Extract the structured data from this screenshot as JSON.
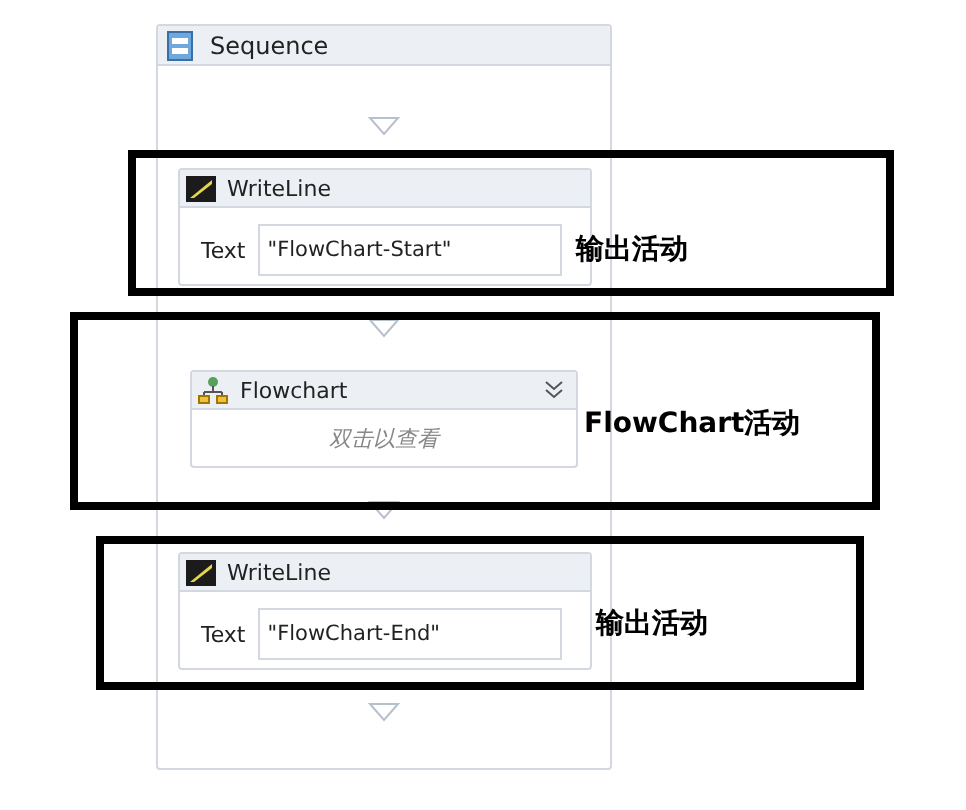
{
  "sequence": {
    "title": "Sequence",
    "activities": [
      {
        "kind": "writeline",
        "title": "WriteLine",
        "field_label": "Text",
        "value": "\"FlowChart-Start\""
      },
      {
        "kind": "flowchart",
        "title": "Flowchart",
        "hint": "双击以查看"
      },
      {
        "kind": "writeline",
        "title": "WriteLine",
        "field_label": "Text",
        "value": "\"FlowChart-End\""
      }
    ]
  },
  "annotations": [
    {
      "label": "输出活动"
    },
    {
      "label": "FlowChart活动"
    },
    {
      "label": "输出活动"
    }
  ]
}
